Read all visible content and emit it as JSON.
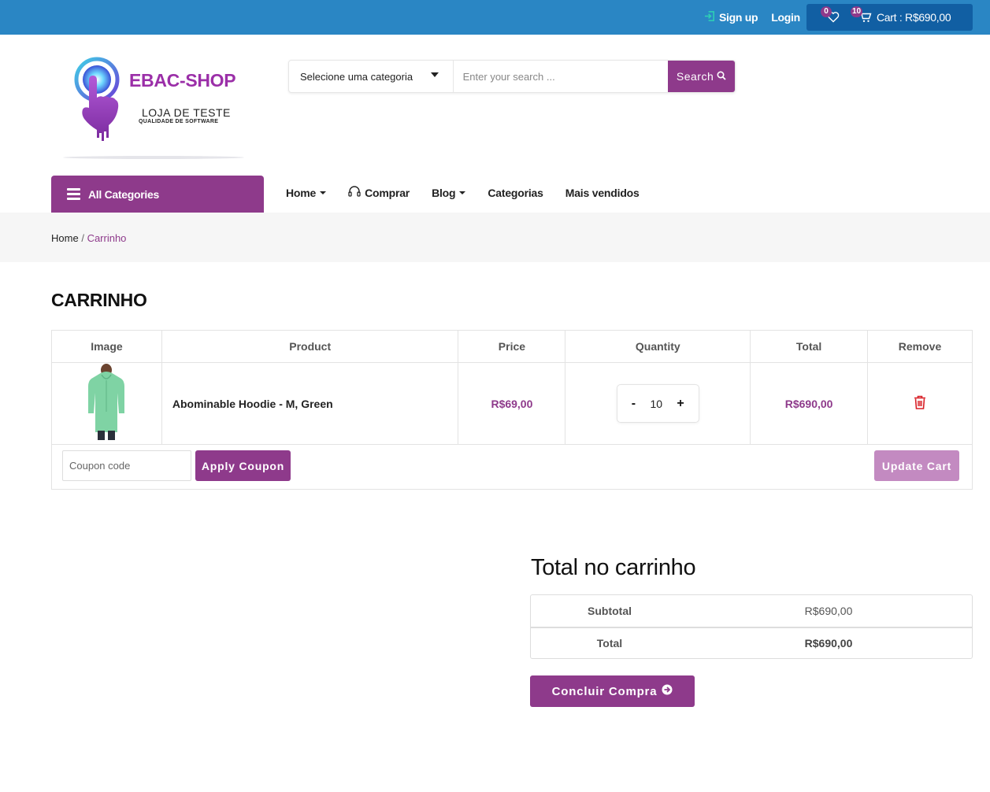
{
  "topbar": {
    "signup_label": "Sign up",
    "login_label": "Login",
    "wishlist_count": "0",
    "cart_count": "10",
    "cart_label": "Cart : R$690,00"
  },
  "logo": {
    "title": "EBAC-SHOP",
    "subtitle": "LOJA DE TESTE",
    "tagline": "QUALIDADE DE SOFTWARE"
  },
  "search": {
    "category_selected": "Selecione uma categoria",
    "placeholder": "Enter your search ...",
    "button_label": "Search"
  },
  "nav": {
    "all_categories": "All Categories",
    "items": [
      {
        "label": "Home"
      },
      {
        "label": "Comprar"
      },
      {
        "label": "Blog"
      },
      {
        "label": "Categorias"
      },
      {
        "label": "Mais vendidos"
      }
    ]
  },
  "breadcrumb": {
    "home": "Home",
    "separator": "/",
    "current": "Carrinho"
  },
  "page_title": "CARRINHO",
  "cart": {
    "headers": [
      "Image",
      "Product",
      "Price",
      "Quantity",
      "Total",
      "Remove"
    ],
    "rows": [
      {
        "product": "Abominable Hoodie - M, Green",
        "price": "R$69,00",
        "quantity": "10",
        "total": "R$690,00"
      }
    ],
    "qty_minus": "-",
    "qty_plus": "+",
    "coupon_placeholder": "Coupon code",
    "apply_coupon": "Apply Coupon",
    "update_cart": "Update Cart"
  },
  "totals": {
    "title": "Total no carrinho",
    "subtotal_label": "Subtotal",
    "subtotal_value": "R$690,00",
    "total_label": "Total",
    "total_value": "R$690,00",
    "checkout_label": "Concluir Compra"
  },
  "colors": {
    "topbar": "#2a86c4",
    "cart_box": "#115fa3",
    "brand_purple": "#8e3a8b",
    "update_button": "#c38ac1",
    "remove_icon": "#d81f26"
  }
}
